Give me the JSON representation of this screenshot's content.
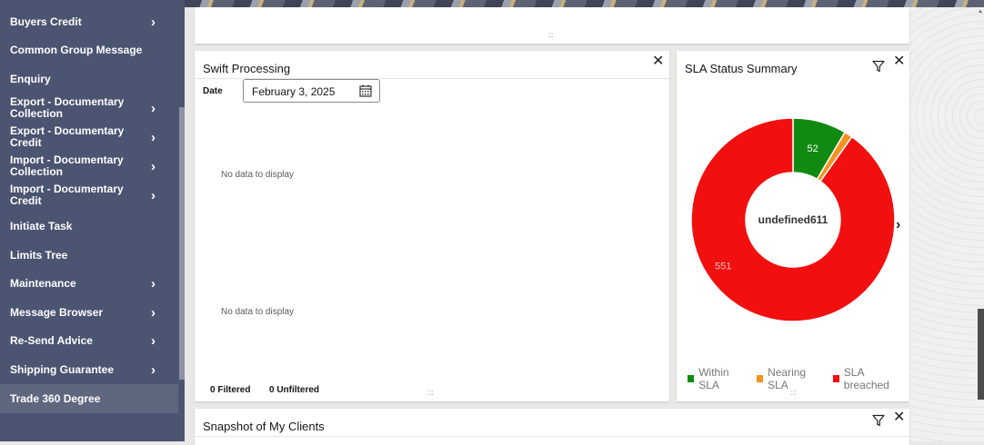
{
  "sidebar": {
    "items": [
      {
        "label": "Buyers Credit",
        "chevron": true
      },
      {
        "label": "Common Group Message",
        "chevron": false
      },
      {
        "label": "Enquiry",
        "chevron": false
      },
      {
        "label": "Export - Documentary Collection",
        "chevron": true
      },
      {
        "label": "Export - Documentary Credit",
        "chevron": true
      },
      {
        "label": "Import - Documentary Collection",
        "chevron": true
      },
      {
        "label": "Import - Documentary Credit",
        "chevron": true
      },
      {
        "label": "Initiate Task",
        "chevron": false
      },
      {
        "label": "Limits Tree",
        "chevron": false
      },
      {
        "label": "Maintenance",
        "chevron": true
      },
      {
        "label": "Message Browser",
        "chevron": true
      },
      {
        "label": "Re-Send Advice",
        "chevron": true
      },
      {
        "label": "Shipping Guarantee",
        "chevron": true
      },
      {
        "label": "Trade 360 Degree",
        "chevron": false,
        "active": true
      }
    ],
    "chevron_glyph": "›"
  },
  "swift": {
    "title": "Swift Processing",
    "date_label": "Date",
    "date_value": "February 3, 2025",
    "no_data_1": "No data to display",
    "no_data_2": "No data to display",
    "filtered": "0 Filtered",
    "unfiltered": "0 Unfiltered"
  },
  "sla": {
    "title": "SLA Status Summary",
    "center_label": "undefined611",
    "legend": [
      {
        "name": "Within SLA",
        "color": "#108a10"
      },
      {
        "name": "Nearing SLA",
        "color": "#f5921e"
      },
      {
        "name": "SLA breached",
        "color": "#f20f0f"
      }
    ]
  },
  "snapshot": {
    "title": "Snapshot of My Clients"
  },
  "glyphs": {
    "close": "✕",
    "handle": ":::",
    "next": "›"
  },
  "chart_data": {
    "type": "pie",
    "categories": [
      "Within SLA",
      "Nearing SLA",
      "SLA breached"
    ],
    "values": [
      52,
      8,
      551
    ],
    "data_labels": [
      "52",
      "",
      "551"
    ],
    "colors": [
      "#108a10",
      "#f5921e",
      "#f20f0f"
    ],
    "center_text": "undefined611",
    "legend_position": "bottom"
  }
}
